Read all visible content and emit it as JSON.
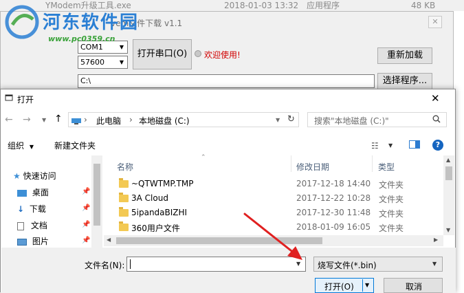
{
  "background_window": {
    "file_row": {
      "name": "YModem升级工具.exe",
      "date": "2018-01-03 13:32",
      "type": "应用程序",
      "size": "48 KB"
    },
    "title_partial": "vem文件下载 v1.1",
    "close_label": "✕",
    "port": "COM1",
    "baud": "57600",
    "open_port_label": "打开串口(O)",
    "welcome": "欢迎使用!",
    "reload_label": "重新加载",
    "select_program_label": "选择程序...",
    "path_value": "C:\\"
  },
  "watermark": {
    "site_name": "河东软件园",
    "url": "www.pc0359.cn"
  },
  "dialog": {
    "title": "打开",
    "close_label": "✕",
    "breadcrumb": [
      "此电脑",
      "本地磁盘 (C:)"
    ],
    "search_placeholder": "搜索\"本地磁盘 (C:)\"",
    "toolbar": {
      "organize": "组织",
      "new_folder": "新建文件夹"
    },
    "sidebar": [
      {
        "label": "快速访问",
        "icon": "star-icon"
      },
      {
        "label": "桌面",
        "icon": "desktop-icon"
      },
      {
        "label": "下载",
        "icon": "download-icon"
      },
      {
        "label": "文档",
        "icon": "document-icon"
      },
      {
        "label": "图片",
        "icon": "picture-icon"
      }
    ],
    "columns": {
      "name": "名称",
      "date": "修改日期",
      "type": "类型"
    },
    "files": [
      {
        "name": "~QTWTMP.TMP",
        "date": "2017-12-18 14:40",
        "type": "文件夹"
      },
      {
        "name": "3A Cloud",
        "date": "2017-12-22 10:28",
        "type": "文件夹"
      },
      {
        "name": "5ipandaBIZHI",
        "date": "2017-12-30 11:48",
        "type": "文件夹"
      },
      {
        "name": "360用户文件",
        "date": "2018-01-09 16:05",
        "type": "文件夹"
      }
    ],
    "filename_label": "文件名(N):",
    "filename_value": "",
    "filter_value": "烧写文件(*.bin)",
    "open_label": "打开(O)",
    "cancel_label": "取消"
  },
  "colors": {
    "accent": "#0078d7",
    "arrow": "#e02020",
    "folder": "#f3c953",
    "welcome": "#d10000"
  }
}
